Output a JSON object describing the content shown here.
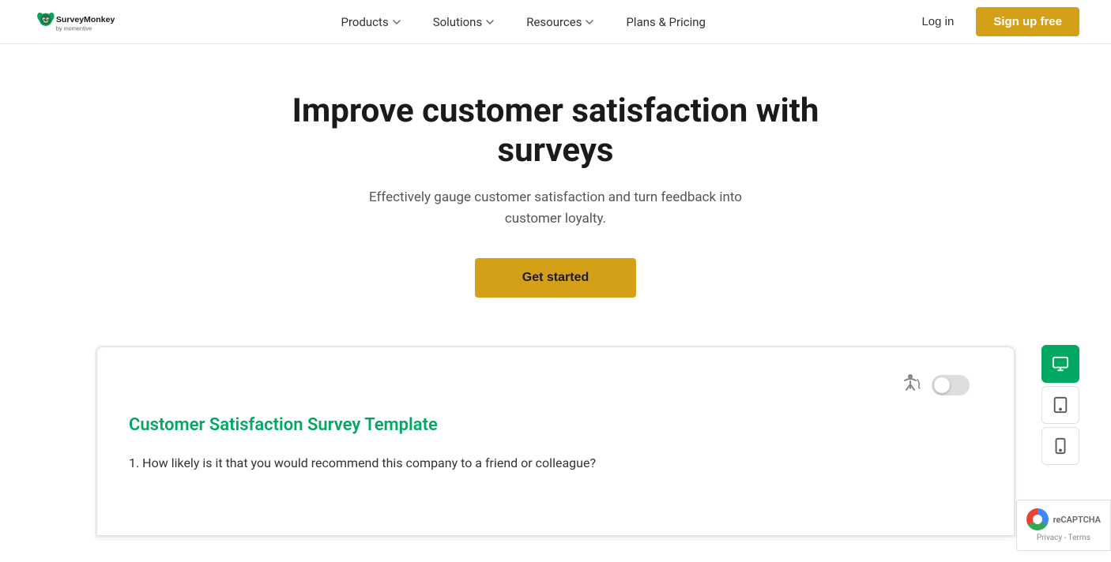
{
  "brand": {
    "name": "SurveyMonkey",
    "tagline": "by momentive"
  },
  "nav": {
    "items": [
      {
        "id": "products",
        "label": "Products",
        "hasDropdown": true
      },
      {
        "id": "solutions",
        "label": "Solutions",
        "hasDropdown": true
      },
      {
        "id": "resources",
        "label": "Resources",
        "hasDropdown": true
      },
      {
        "id": "pricing",
        "label": "Plans & Pricing",
        "hasDropdown": false
      }
    ],
    "login_label": "Log in",
    "signup_label": "Sign up free"
  },
  "hero": {
    "title": "Improve customer satisfaction with surveys",
    "subtitle": "Effectively gauge customer satisfaction and turn feedback into customer loyalty.",
    "cta_label": "Get started"
  },
  "survey_preview": {
    "template_title": "Customer Satisfaction Survey Template",
    "question": "1. How likely is it that you would recommend this company to a friend or colleague?"
  },
  "device_sidebar": {
    "desktop_label": "Desktop view",
    "tablet_label": "Tablet view",
    "mobile_label": "Mobile view"
  },
  "recaptcha": {
    "line1": "Privacy - Terms"
  }
}
